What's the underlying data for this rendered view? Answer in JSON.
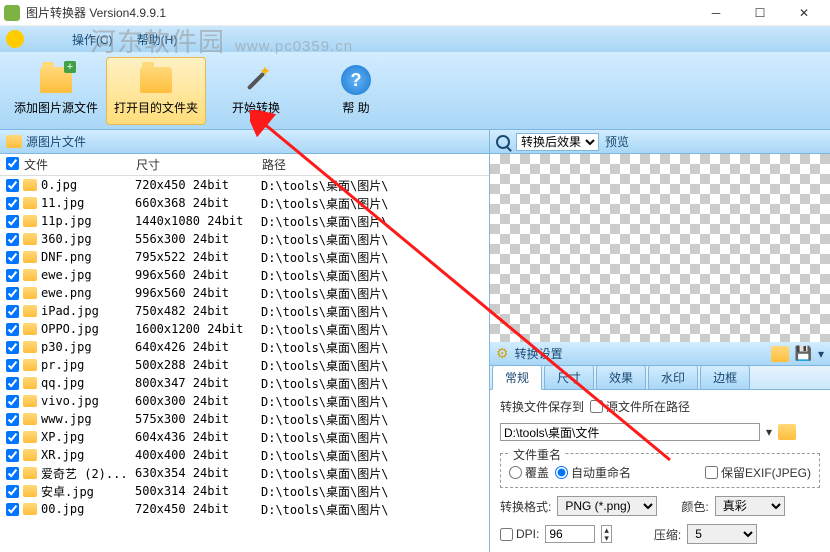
{
  "window": {
    "title": "图片转换器 Version4.9.9.1"
  },
  "menu": {
    "operate": "操作(C)",
    "help": "帮助(H)"
  },
  "toolbar": {
    "add_source": "添加图片源文件",
    "open_target": "打开目的文件夹",
    "start_convert": "开始转换",
    "help": "帮 助"
  },
  "panes": {
    "source_title": "源图片文件",
    "col_file": "文件",
    "col_size": "尺寸",
    "col_path": "路径"
  },
  "files": [
    {
      "name": "0.jpg",
      "size": "720x450  24bit",
      "path": "D:\\tools\\桌面\\图片\\"
    },
    {
      "name": "11.jpg",
      "size": "660x368  24bit",
      "path": "D:\\tools\\桌面\\图片\\"
    },
    {
      "name": "11p.jpg",
      "size": "1440x1080  24bit",
      "path": "D:\\tools\\桌面\\图片\\"
    },
    {
      "name": "360.jpg",
      "size": "556x300  24bit",
      "path": "D:\\tools\\桌面\\图片\\"
    },
    {
      "name": "DNF.png",
      "size": "795x522  24bit",
      "path": "D:\\tools\\桌面\\图片\\"
    },
    {
      "name": "ewe.jpg",
      "size": "996x560  24bit",
      "path": "D:\\tools\\桌面\\图片\\"
    },
    {
      "name": "ewe.png",
      "size": "996x560  24bit",
      "path": "D:\\tools\\桌面\\图片\\"
    },
    {
      "name": "iPad.jpg",
      "size": "750x482  24bit",
      "path": "D:\\tools\\桌面\\图片\\"
    },
    {
      "name": "OPPO.jpg",
      "size": "1600x1200  24bit",
      "path": "D:\\tools\\桌面\\图片\\"
    },
    {
      "name": "p30.jpg",
      "size": "640x426  24bit",
      "path": "D:\\tools\\桌面\\图片\\"
    },
    {
      "name": "pr.jpg",
      "size": "500x288  24bit",
      "path": "D:\\tools\\桌面\\图片\\"
    },
    {
      "name": "qq.jpg",
      "size": "800x347  24bit",
      "path": "D:\\tools\\桌面\\图片\\"
    },
    {
      "name": "vivo.jpg",
      "size": "600x300  24bit",
      "path": "D:\\tools\\桌面\\图片\\"
    },
    {
      "name": "www.jpg",
      "size": "575x300  24bit",
      "path": "D:\\tools\\桌面\\图片\\"
    },
    {
      "name": "XP.jpg",
      "size": "604x436  24bit",
      "path": "D:\\tools\\桌面\\图片\\"
    },
    {
      "name": "XR.jpg",
      "size": "400x400  24bit",
      "path": "D:\\tools\\桌面\\图片\\"
    },
    {
      "name": "爱奇艺 (2)...",
      "size": "630x354  24bit",
      "path": "D:\\tools\\桌面\\图片\\"
    },
    {
      "name": "安卓.jpg",
      "size": "500x314  24bit",
      "path": "D:\\tools\\桌面\\图片\\"
    },
    {
      "name": "00.jpg",
      "size": "720x450  24bit",
      "path": "D:\\tools\\桌面\\图片\\"
    }
  ],
  "preview": {
    "dropdown": "转换后效果",
    "label": "预览"
  },
  "settings": {
    "title": "转换设置",
    "tabs": {
      "general": "常规",
      "size": "尺寸",
      "effect": "效果",
      "watermark": "水印",
      "border": "边框"
    },
    "save_to_label": "转换文件保存到",
    "source_path_label": "源文件所在路径",
    "path_value": "D:\\tools\\桌面\\文件",
    "rename_legend": "文件重名",
    "overwrite": "覆盖",
    "auto_rename": "自动重命名",
    "keep_exif": "保留EXIF(JPEG)",
    "format_label": "转换格式:",
    "format_value": "PNG (*.png)",
    "color_label": "颜色:",
    "color_value": "真彩",
    "dpi_label": "DPI:",
    "dpi_value": "96",
    "compress_label": "压缩:",
    "compress_value": "5"
  },
  "watermark": {
    "text": "河东软件园",
    "url": "www.pc0359.cn"
  }
}
